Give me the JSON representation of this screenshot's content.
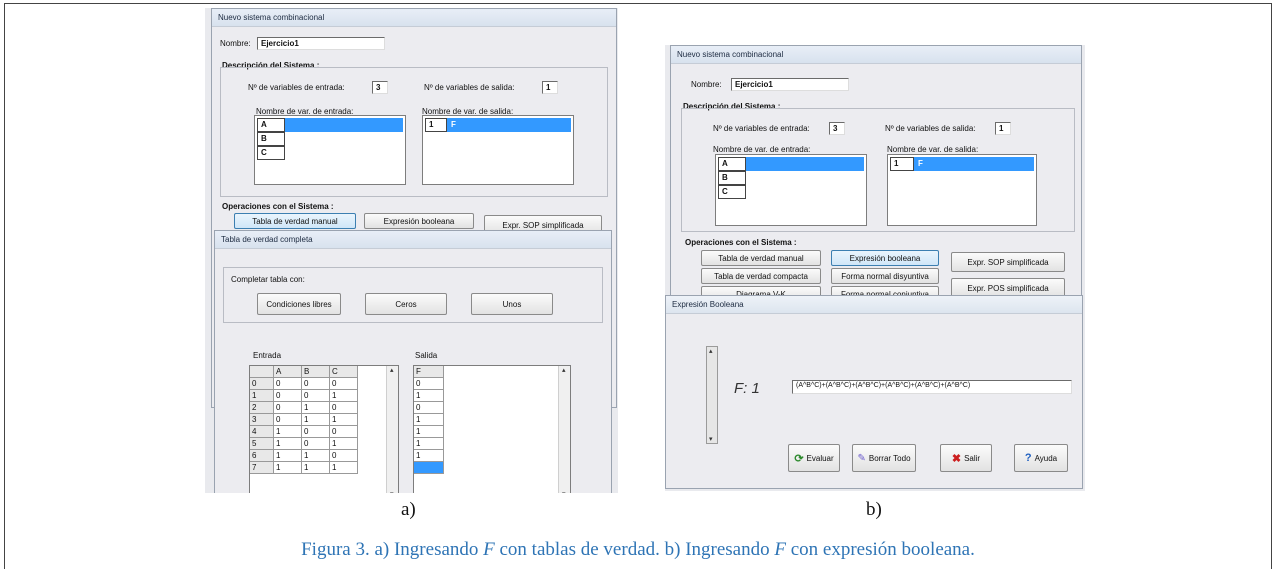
{
  "panel_a": {
    "window_title": "Nuevo sistema combinacional",
    "name_label": "Nombre:",
    "name_value": "Ejercicio1",
    "desc_group": "Descripción del Sistema :",
    "in_count_label": "Nº de variables de entrada:",
    "in_count_value": "3",
    "out_count_label": "Nº de variables de salida:",
    "out_count_value": "1",
    "in_names_label": "Nombre de var. de entrada:",
    "out_names_label": "Nombre de var. de salida:",
    "in_vars": [
      "A",
      "B",
      "C"
    ],
    "out_vars": [
      {
        "index": "1",
        "name": "F"
      }
    ],
    "ops_group": "Operaciones con el Sistema :",
    "ops_buttons": [
      "Tabla de verdad manual",
      "Expresión booleana",
      "Expr. SOP simplificada"
    ],
    "sub_window_title": "Tabla de verdad completa",
    "fill_label": "Completar tabla con:",
    "fill_buttons": [
      "Condiciones libres",
      "Ceros",
      "Unos"
    ],
    "entrada_label": "Entrada",
    "salida_label": "Salida",
    "table_headers": [
      "",
      "A",
      "B",
      "C"
    ],
    "table_rows": [
      [
        "0",
        "0",
        "0",
        "0"
      ],
      [
        "1",
        "0",
        "0",
        "1"
      ],
      [
        "2",
        "0",
        "1",
        "0"
      ],
      [
        "3",
        "0",
        "1",
        "1"
      ],
      [
        "4",
        "1",
        "0",
        "0"
      ],
      [
        "5",
        "1",
        "0",
        "1"
      ],
      [
        "6",
        "1",
        "1",
        "0"
      ],
      [
        "7",
        "1",
        "1",
        "1"
      ]
    ],
    "output_header": "F",
    "output_values": [
      "0",
      "1",
      "0",
      "1",
      "1",
      "1",
      "1",
      ""
    ]
  },
  "panel_b": {
    "window_title": "Nuevo sistema combinacional",
    "name_label": "Nombre:",
    "name_value": "Ejercicio1",
    "desc_group": "Descripción del Sistema :",
    "in_count_label": "Nº de variables de entrada:",
    "in_count_value": "3",
    "out_count_label": "Nº de variables de salida:",
    "out_count_value": "1",
    "in_names_label": "Nombre de var. de entrada:",
    "out_names_label": "Nombre de var. de salida:",
    "in_vars": [
      "A",
      "B",
      "C"
    ],
    "out_vars": [
      {
        "index": "1",
        "name": "F"
      }
    ],
    "ops_group": "Operaciones con el Sistema :",
    "ops_col1": [
      "Tabla de verdad manual",
      "Tabla de verdad compacta",
      "Diagrama V-K"
    ],
    "ops_col2": [
      "Expresión booleana",
      "Forma normal disyuntiva",
      "Forma normal conjuntiva"
    ],
    "ops_col3": [
      "Expr. SOP simplificada",
      "Expr. POS simplificada"
    ],
    "dialog_title": "Expresión Booleana",
    "func_label": "F: 1",
    "expression": "(A^B^C)+(A^B^C)+(A^B^C)+(A^B^C)+(A^B^C)+(A^B^C)",
    "dialog_buttons": [
      {
        "label": "Evaluar",
        "icon": "refresh-icon"
      },
      {
        "label": "Borrar Todo",
        "icon": "eraser-icon"
      },
      {
        "label": "Salir",
        "icon": "close-icon"
      },
      {
        "label": "Ayuda",
        "icon": "help-icon"
      }
    ],
    "accent_color": "#3399ff"
  },
  "labels": {
    "a": "a)",
    "b": "b)"
  },
  "caption": {
    "prefix": "Figura 3. a) Ingresando ",
    "var1": "F",
    "middle": " con tablas de verdad. b) Ingresando ",
    "var2": "F",
    "suffix": " con expresión booleana.",
    "color": "#2e74b5"
  }
}
